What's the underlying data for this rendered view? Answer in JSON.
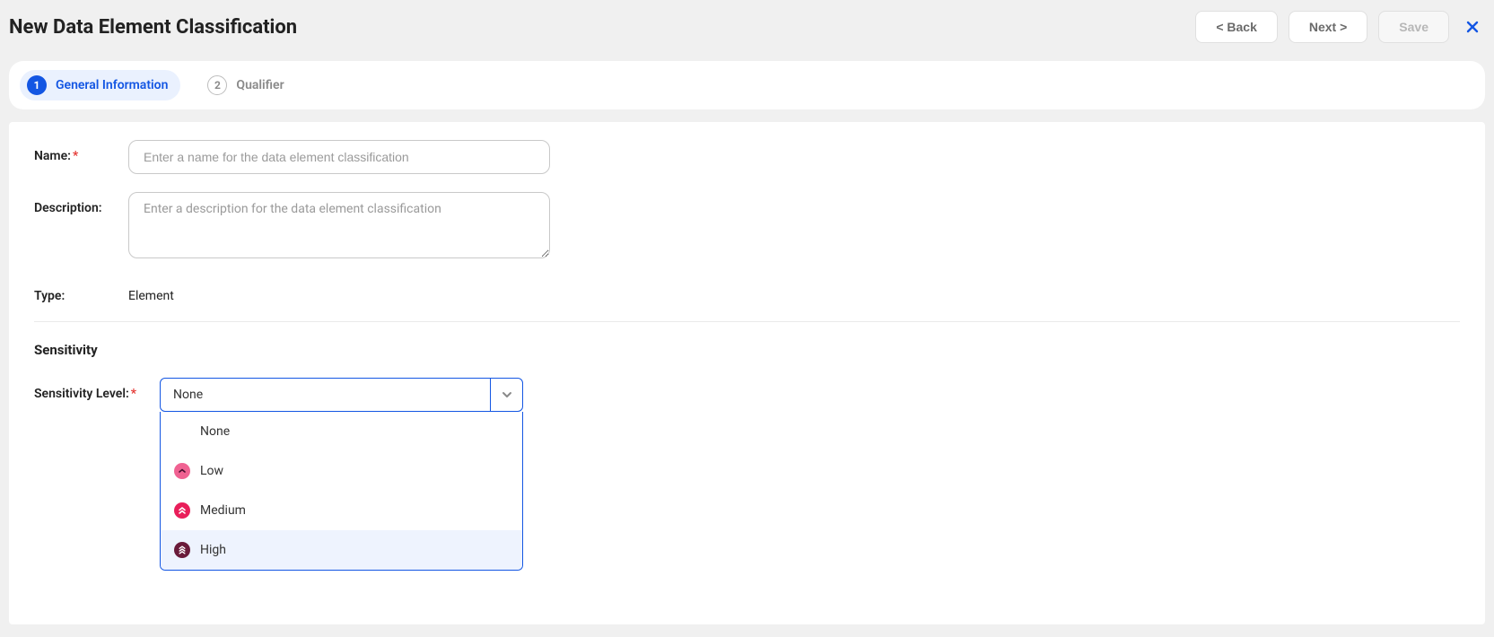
{
  "header": {
    "title": "New Data Element Classification",
    "back_label": "< Back",
    "next_label": "Next >",
    "save_label": "Save"
  },
  "steps": {
    "step1": {
      "number": "1",
      "label": "General Information"
    },
    "step2": {
      "number": "2",
      "label": "Qualifier"
    }
  },
  "form": {
    "name_label": "Name:",
    "name_placeholder": "Enter a name for the data element classification",
    "name_value": "",
    "description_label": "Description:",
    "description_placeholder": "Enter a description for the data element classification",
    "description_value": "",
    "type_label": "Type:",
    "type_value": "Element"
  },
  "sensitivity": {
    "heading": "Sensitivity",
    "level_label": "Sensitivity Level:",
    "selected_value": "None",
    "options": {
      "none": "None",
      "low": "Low",
      "medium": "Medium",
      "high": "High"
    }
  }
}
